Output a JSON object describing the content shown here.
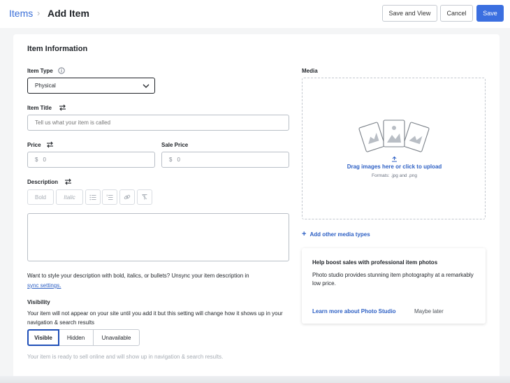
{
  "header": {
    "breadcrumb_link": "Items",
    "breadcrumb_separator": "›",
    "page_title": "Add Item",
    "save_and_view_label": "Save and View",
    "cancel_label": "Cancel",
    "save_label": "Save"
  },
  "form": {
    "section_title": "Item Information",
    "item_type": {
      "label": "Item Type",
      "value": "Physical"
    },
    "item_title": {
      "label": "Item Title",
      "placeholder": "Tell us what your item is called",
      "value": ""
    },
    "price": {
      "label": "Price",
      "currency": "$",
      "value": "0"
    },
    "sale_price": {
      "label": "Sale Price",
      "currency": "$",
      "value": "0"
    },
    "description": {
      "label": "Description",
      "toolbar": {
        "bold": "Bold",
        "italic": "Italic"
      },
      "value": ""
    },
    "sync_help": {
      "text": "Want to style your description with bold, italics, or bullets? Unsync your item description in",
      "link": "sync settings."
    },
    "visibility": {
      "label": "Visibility",
      "help": "Your item will not appear on your site until you add it but this setting will change how it shows up in your navigation & search results",
      "options": [
        "Visible",
        "Hidden",
        "Unavailable"
      ],
      "selected": "Visible",
      "status": "Your item is ready to sell online and will show up in navigation & search results."
    }
  },
  "media": {
    "label": "Media",
    "upload_text": "Drag images here or click to upload",
    "formats": "Formats: .jpg and .png",
    "add_other": "Add other media types"
  },
  "promo": {
    "title": "Help boost sales with professional item photos",
    "body": "Photo studio provides stunning item photography at a remarkably low price.",
    "learn_more": "Learn more about Photo Studio",
    "maybe_later": "Maybe later"
  },
  "colors": {
    "accent": "#3b6fe0",
    "link": "#2c5fc4",
    "text": "#1f2328"
  }
}
